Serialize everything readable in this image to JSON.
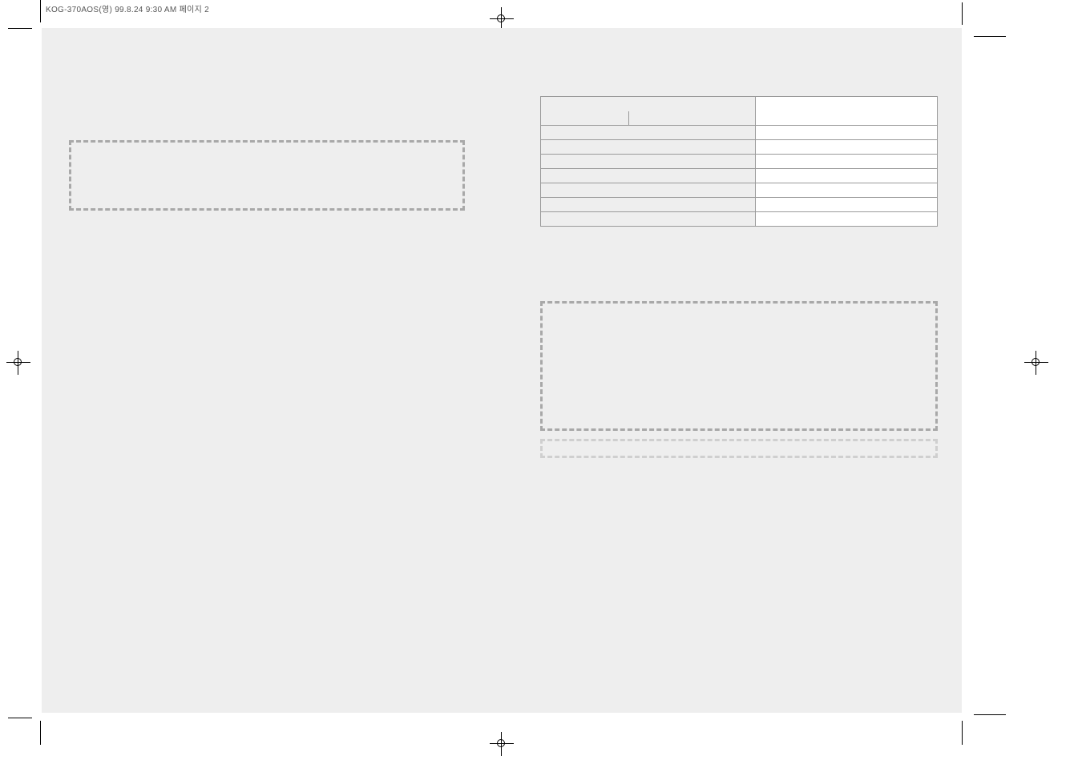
{
  "header": {
    "file_label": "KOG-370AOS(영) 99.8.24 9:30 AM 페이지 2"
  },
  "left_page": {
    "dashed_box": ""
  },
  "right_page": {
    "table": {
      "rows": [
        {
          "type": "merge3",
          "c1": "",
          "c2a": "",
          "c2b": "",
          "c3a": "",
          "c3b": "",
          "c3c": ""
        },
        {
          "c1": "",
          "c2": ""
        },
        {
          "c1": "",
          "c2": ""
        },
        {
          "c1": "",
          "c2": ""
        },
        {
          "c1": "",
          "c2": ""
        },
        {
          "c1": "",
          "c2": ""
        },
        {
          "c1": "",
          "c2": ""
        },
        {
          "c1": "",
          "c2": ""
        }
      ]
    },
    "dashed_box_large": "",
    "dashed_box_small": ""
  }
}
